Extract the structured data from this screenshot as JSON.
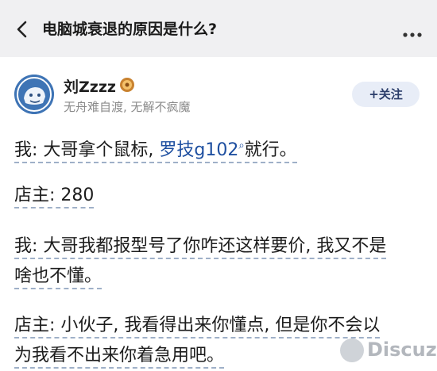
{
  "header": {
    "title": "电脑城衰退的原因是什么?"
  },
  "author": {
    "name": "刘Zzzz",
    "signature": "无舟难自渡, 无解不疯魔",
    "follow_label": "+关注"
  },
  "post": {
    "p1_prefix": "我: 大哥拿个鼠标, ",
    "p1_link": "罗技g102",
    "p1_suffix": "就行。",
    "p2": "店主: 280",
    "p3_line1": "我: 大哥我都报型号了你咋还这样要价, 我又不是",
    "p3_line2": "啥也不懂。",
    "p4_line1": "店主: 小伙子, 我看得出来你懂点, 但是你不会以",
    "p4_line2": "为我看不出来你着急用吧。"
  },
  "watermark": {
    "text": "Discuz!"
  },
  "colors": {
    "header_bg": "#f0f0f2",
    "link": "#1e4fa0",
    "follow_bg": "#e8edf7",
    "underline": "#9fb0c8"
  }
}
